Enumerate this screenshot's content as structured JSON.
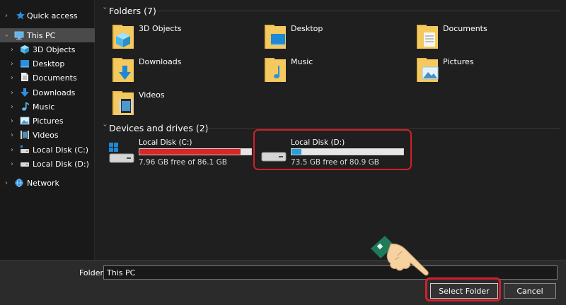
{
  "sidebar": {
    "items": [
      {
        "label": "Quick access",
        "icon": "star-icon",
        "selected": false
      },
      {
        "label": "This PC",
        "icon": "computer-icon",
        "selected": true
      },
      {
        "label": "3D Objects",
        "icon": "cube-icon",
        "selected": false
      },
      {
        "label": "Desktop",
        "icon": "desktop-icon",
        "selected": false
      },
      {
        "label": "Documents",
        "icon": "document-icon",
        "selected": false
      },
      {
        "label": "Downloads",
        "icon": "download-icon",
        "selected": false
      },
      {
        "label": "Music",
        "icon": "music-icon",
        "selected": false
      },
      {
        "label": "Pictures",
        "icon": "picture-icon",
        "selected": false
      },
      {
        "label": "Videos",
        "icon": "video-icon",
        "selected": false
      },
      {
        "label": "Local Disk (C:)",
        "icon": "drive-icon",
        "selected": false
      },
      {
        "label": "Local Disk (D:)",
        "icon": "drive-icon",
        "selected": false
      },
      {
        "label": "Network",
        "icon": "network-icon",
        "selected": false
      }
    ]
  },
  "folders": {
    "title": "Folders (7)",
    "items": [
      {
        "label": "3D Objects",
        "icon": "cube-folder-icon"
      },
      {
        "label": "Desktop",
        "icon": "desktop-folder-icon"
      },
      {
        "label": "Documents",
        "icon": "documents-folder-icon"
      },
      {
        "label": "Downloads",
        "icon": "downloads-folder-icon"
      },
      {
        "label": "Music",
        "icon": "music-folder-icon"
      },
      {
        "label": "Pictures",
        "icon": "pictures-folder-icon"
      },
      {
        "label": "Videos",
        "icon": "videos-folder-icon"
      }
    ]
  },
  "drives": {
    "title": "Devices and drives (2)",
    "items": [
      {
        "name": "Local Disk (C:)",
        "free": "7.96 GB free of 86.1 GB",
        "used_fraction": 0.908,
        "bar_color": "#da2626",
        "icon": "windows-drive-icon"
      },
      {
        "name": "Local Disk (D:)",
        "free": "73.5 GB free of 80.9 GB",
        "used_fraction": 0.091,
        "bar_color": "#26a0da",
        "icon": "hard-drive-icon"
      }
    ]
  },
  "footer": {
    "folder_label": "Folder:",
    "folder_value": "This PC",
    "select_label": "Select Folder",
    "cancel_label": "Cancel"
  },
  "colors": {
    "highlight": "#d21f2a",
    "folder_yellow": "#f4c95d",
    "accent_blue": "#26a0da"
  }
}
